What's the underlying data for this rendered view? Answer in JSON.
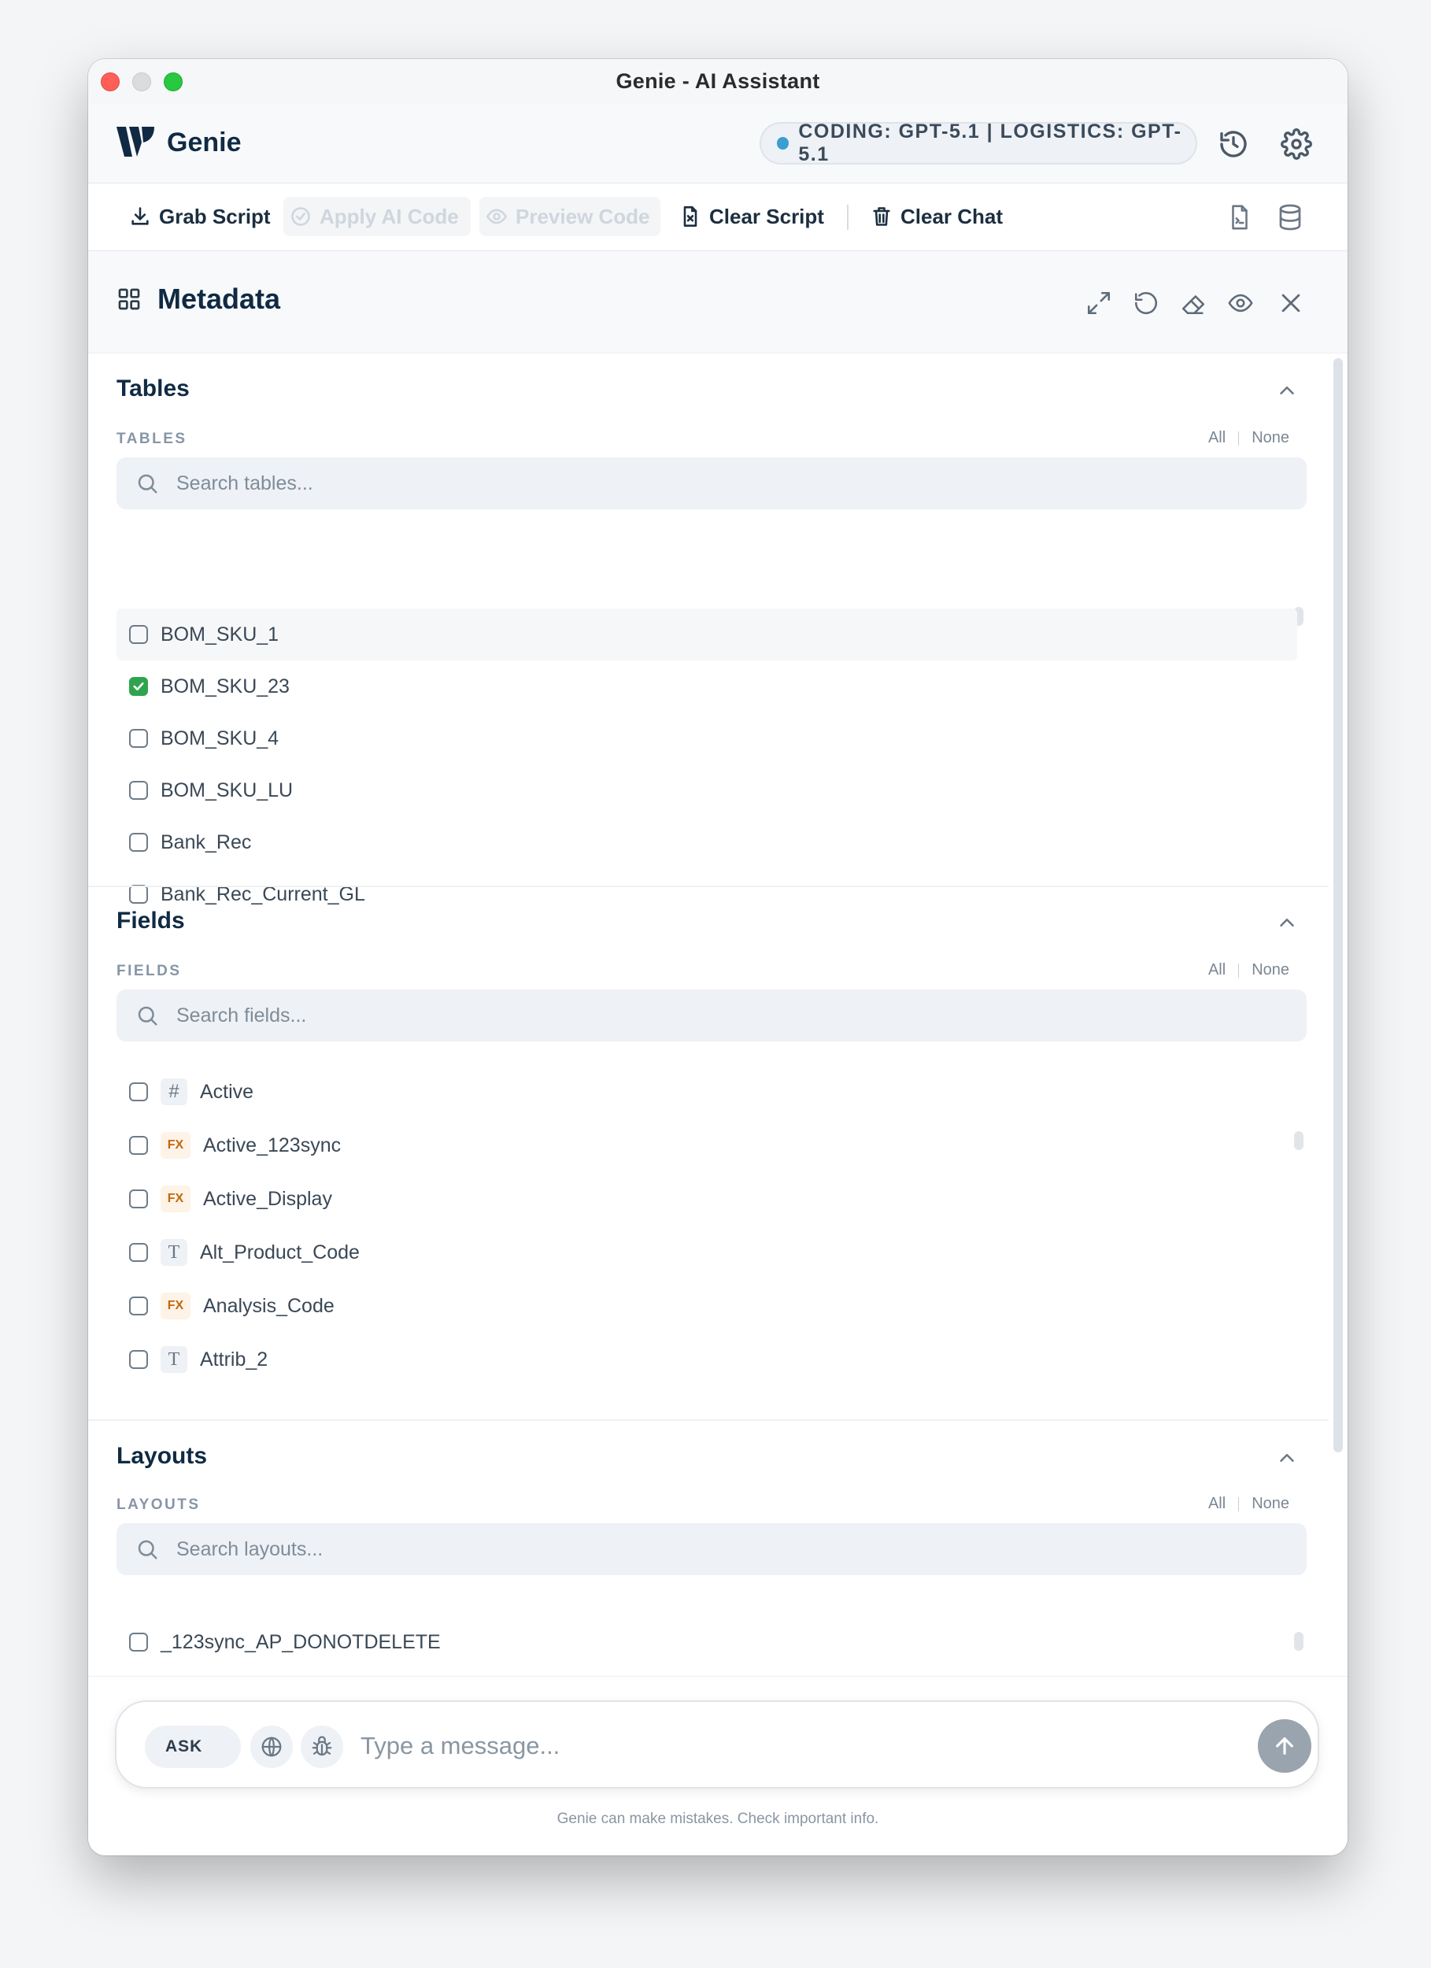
{
  "window": {
    "title": "Genie - AI Assistant"
  },
  "header": {
    "brand": "Genie",
    "model_status": "CODING: GPT-5.1 | LOGISTICS: GPT-5.1",
    "status_color": "#3a9fd0"
  },
  "toolbar": {
    "grab_script": "Grab Script",
    "apply_ai_code": "Apply AI Code",
    "preview_code": "Preview Code",
    "clear_script": "Clear Script",
    "clear_chat": "Clear Chat"
  },
  "metadata": {
    "title": "Metadata",
    "sections": {
      "tables": {
        "title": "Tables",
        "subtitle": "TABLES",
        "all": "All",
        "none": "None",
        "search_placeholder": "Search tables...",
        "items": [
          {
            "label": "BOM_SKU_1",
            "checked": false
          },
          {
            "label": "BOM_SKU_23",
            "checked": true
          },
          {
            "label": "BOM_SKU_4",
            "checked": false
          },
          {
            "label": "BOM_SKU_LU",
            "checked": false
          },
          {
            "label": "Bank_Rec",
            "checked": false
          },
          {
            "label": "Bank_Rec_Current_GL",
            "checked": false
          }
        ]
      },
      "fields": {
        "title": "Fields",
        "subtitle": "FIELDS",
        "all": "All",
        "none": "None",
        "search_placeholder": "Search fields...",
        "items": [
          {
            "label": "Active",
            "type": "#"
          },
          {
            "label": "Active_123sync",
            "type": "FX"
          },
          {
            "label": "Active_Display",
            "type": "FX"
          },
          {
            "label": "Alt_Product_Code",
            "type": "T"
          },
          {
            "label": "Analysis_Code",
            "type": "FX"
          },
          {
            "label": "Attrib_2",
            "type": "T"
          }
        ]
      },
      "layouts": {
        "title": "Layouts",
        "subtitle": "LAYOUTS",
        "all": "All",
        "none": "None",
        "search_placeholder": "Search layouts...",
        "items": [
          {
            "label": "_123sync_AP_DONOTDELETE"
          }
        ]
      }
    }
  },
  "chat": {
    "mode": "ASK",
    "placeholder": "Type a message...",
    "disclaimer": "Genie can make mistakes. Check important info."
  }
}
